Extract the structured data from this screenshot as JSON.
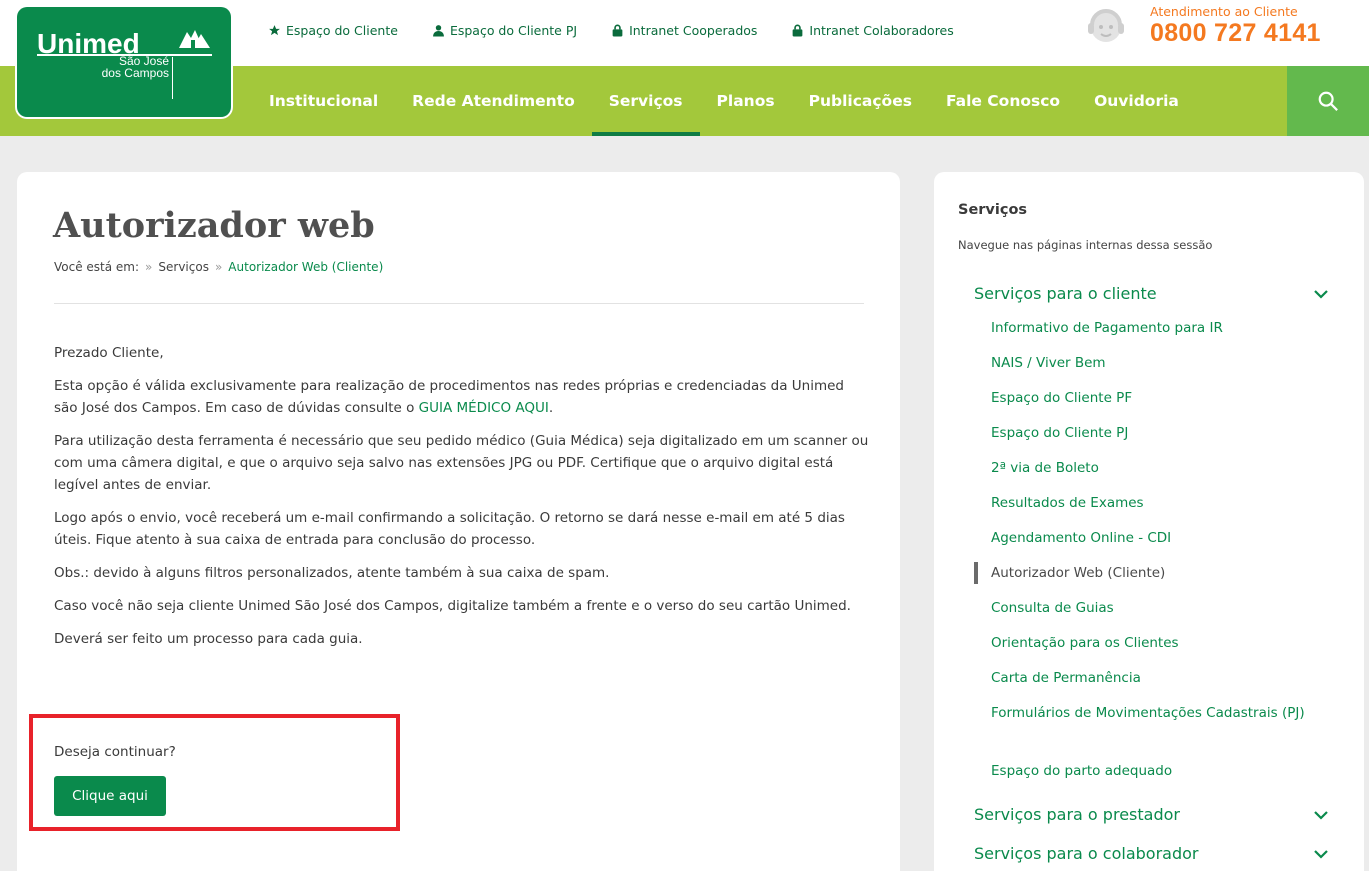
{
  "brand": {
    "name": "Unimed",
    "subtitle_line1": "São José",
    "subtitle_line2": "dos Campos",
    "primary": "#0a8a4c",
    "nav_bg": "#a3c83b",
    "accent": "#f47920"
  },
  "toplinks": [
    {
      "label": "Espaço do Cliente",
      "icon": "star-icon"
    },
    {
      "label": "Espaço do Cliente PJ",
      "icon": "user-icon"
    },
    {
      "label": "Intranet Cooperados",
      "icon": "lock-icon"
    },
    {
      "label": "Intranet Colaboradores",
      "icon": "lock-icon"
    }
  ],
  "support": {
    "label": "Atendimento ao Cliente",
    "phone": "0800 727 4141"
  },
  "nav": {
    "items": [
      "Institucional",
      "Rede Atendimento",
      "Serviços",
      "Planos",
      "Publicações",
      "Fale Conosco",
      "Ouvidoria"
    ],
    "active": "Serviços",
    "search_icon": "search-icon"
  },
  "page": {
    "title": "Autorizador web",
    "breadcrumb": {
      "prefix": "Você está em:",
      "sep": "»",
      "items": [
        "Serviços",
        "Autorizador Web (Cliente)"
      ]
    },
    "paragraphs": {
      "greeting": "Prezado Cliente,",
      "p1_text": "Esta opção é válida exclusivamente para realização de procedimentos nas redes próprias e credenciadas da Unimed são José dos Campos. Em caso de dúvidas consulte o ",
      "p1_link": "GUIA MÉDICO AQUI",
      "p1_end": ".",
      "p2": "Para utilização desta ferramenta é necessário que seu pedido médico (Guia Médica) seja digitalizado em um scanner ou com uma câmera digital, e que o arquivo seja salvo nas extensões JPG ou PDF. Certifique que o arquivo digital está legível antes de enviar.",
      "p3": "Logo após o envio, você receberá um e-mail confirmando a solicitação. O retorno se dará nesse e-mail em até 5 dias úteis. Fique atento à sua caixa de entrada para conclusão do processo.",
      "p4": "Obs.: devido à alguns filtros personalizados, atente também à sua caixa de spam.",
      "p5": "Caso você não seja cliente Unimed São José dos Campos, digitalize também a frente e o verso do seu cartão Unimed.",
      "p6": "Deverá ser feito um processo para cada guia."
    },
    "continue_question": "Deseja continuar?",
    "cta_label": "Clique aqui",
    "highlight_color": "#e8222a"
  },
  "sidebar": {
    "title": "Serviços",
    "subtitle": "Navegue nas páginas internas dessa sessão",
    "sections": [
      {
        "label": "Serviços para o cliente",
        "icon": "chevron-down-icon"
      },
      {
        "label": "Serviços para o prestador",
        "icon": "chevron-down-icon"
      },
      {
        "label": "Serviços para o colaborador",
        "icon": "chevron-down-icon"
      }
    ],
    "client_items": [
      "Informativo de Pagamento para IR",
      "NAIS / Viver Bem",
      "Espaço do Cliente PF",
      "Espaço do Cliente PJ",
      "2ª via de Boleto",
      "Resultados de Exames",
      "Agendamento Online - CDI",
      "Autorizador Web (Cliente)",
      "Consulta de Guias",
      "Orientação para os Clientes",
      "Carta de Permanência",
      "Formulários de Movimentações Cadastrais (PJ)",
      "Espaço do parto adequado"
    ],
    "current_item": "Autorizador Web (Cliente)"
  }
}
